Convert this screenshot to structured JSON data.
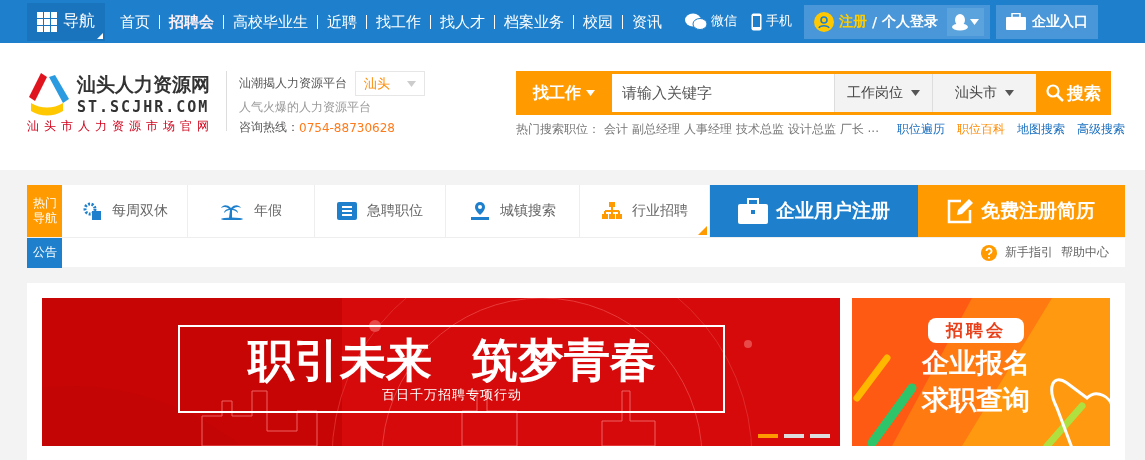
{
  "topbar": {
    "nav": "导航",
    "links": [
      {
        "label": "首页",
        "emphasized": false
      },
      {
        "label": "招聘会",
        "emphasized": true
      },
      {
        "label": "高校毕业生",
        "emphasized": false
      },
      {
        "label": "近聘",
        "emphasized": false
      },
      {
        "label": "找工作",
        "emphasized": false
      },
      {
        "label": "找人才",
        "emphasized": false
      },
      {
        "label": "档案业务",
        "emphasized": false
      },
      {
        "label": "校园",
        "emphasized": false
      },
      {
        "label": "资讯",
        "emphasized": false
      }
    ],
    "wechat": "微信",
    "phone": "手机",
    "register": "注册",
    "slash": "/",
    "login": "个人登录",
    "enterprise": "企业入口"
  },
  "header": {
    "logo_title": "汕头人力资源网",
    "logo_domain": "ST.SCJHR.COM",
    "logo_slogan": "汕头市人力资源市场官网",
    "platform": "汕潮揭人力资源平台",
    "city": "汕头",
    "tagline": "人气火爆的人力资源平台",
    "hotline_label": "咨询热线：",
    "hotline": "0754-88730628"
  },
  "search": {
    "type": "找工作",
    "placeholder": "请输入关键字",
    "position": "工作岗位",
    "city": "汕头市",
    "button": "搜索",
    "hot_label": "热门搜索职位：",
    "hot_terms": [
      "会计",
      "副总经理",
      "人事经理",
      "技术总监",
      "设计总监",
      "厂长",
      "..."
    ],
    "links": [
      {
        "label": "职位遍历",
        "highlighted": false
      },
      {
        "label": "职位百科",
        "highlighted": true
      },
      {
        "label": "地图搜索",
        "highlighted": false
      },
      {
        "label": "高级搜索",
        "highlighted": false
      }
    ]
  },
  "hot_nav": {
    "label": "热门导航",
    "items": [
      "每周双休",
      "年假",
      "急聘职位",
      "城镇搜索",
      "行业招聘"
    ],
    "cta": [
      {
        "label": "企业用户注册",
        "color": "#1e80cc"
      },
      {
        "label": "免费注册简历",
        "color": "#ff9a00"
      }
    ],
    "notice_label": "公告",
    "help": [
      "新手指引",
      "帮助中心"
    ]
  },
  "banner": {
    "headline": [
      "职引未来",
      "筑梦青春"
    ],
    "subtitle": "百日千万招聘专项行动",
    "dots": [
      {
        "selected": true
      },
      {
        "selected": false
      },
      {
        "selected": false
      }
    ]
  },
  "side_banner": {
    "badge": "招聘会",
    "lines": [
      "企业报名",
      "求职查询"
    ]
  }
}
